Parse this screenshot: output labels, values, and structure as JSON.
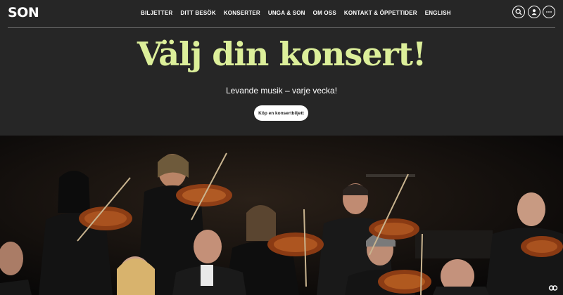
{
  "header": {
    "logo": "SON",
    "nav": [
      "BILJETTER",
      "DITT BESÖK",
      "KONSERTER",
      "UNGA & SON",
      "OM OSS",
      "KONTAKT & ÖPPETTIDER",
      "ENGLISH"
    ],
    "icons": [
      "search-icon",
      "user-icon",
      "more-icon"
    ]
  },
  "hero": {
    "title": "Välj din konsert!",
    "subtitle": "Levande musik – varje vecka!",
    "cta": "Köp en konsertbiljett"
  },
  "photo": {
    "description_icon": "orchestra-photo",
    "caption_button_icon": "cc-icon"
  },
  "colors": {
    "background": "#262626",
    "accent": "#dcef9a",
    "button_bg": "#ffffff"
  }
}
